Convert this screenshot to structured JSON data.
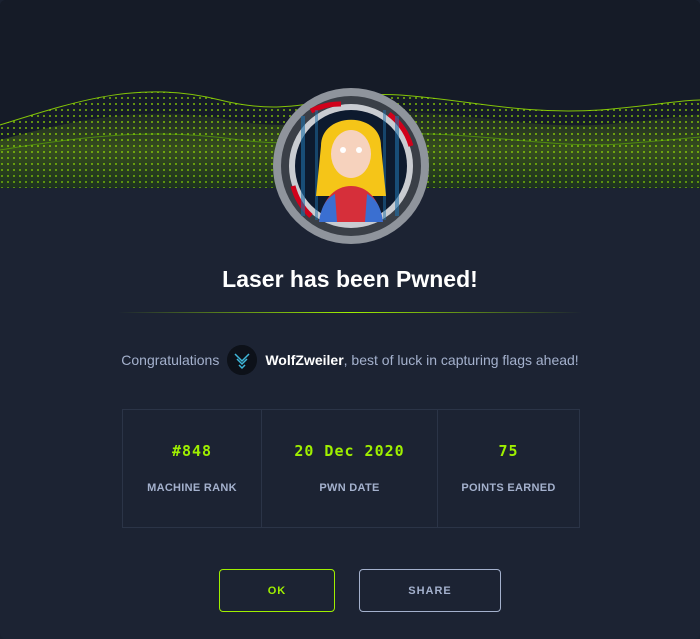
{
  "dialog": {
    "title": "Laser has been Pwned!",
    "congrats_prefix": "Congratulations",
    "username": "WolfZweiler",
    "congrats_suffix": ", best of luck in capturing flags ahead!"
  },
  "stats": [
    {
      "value": "#848",
      "label": "MACHINE RANK"
    },
    {
      "value": "20 Dec 2020",
      "label": "PWN DATE"
    },
    {
      "value": "75",
      "label": "POINTS EARNED"
    }
  ],
  "buttons": {
    "ok_label": "OK",
    "share_label": "SHARE"
  },
  "colors": {
    "accent": "#9fef00",
    "background": "#1c2333",
    "muted_text": "#a4b1cd"
  },
  "icons": {
    "machine_avatar": "machine-avatar-icon",
    "user_avatar": "user-avatar-icon"
  }
}
